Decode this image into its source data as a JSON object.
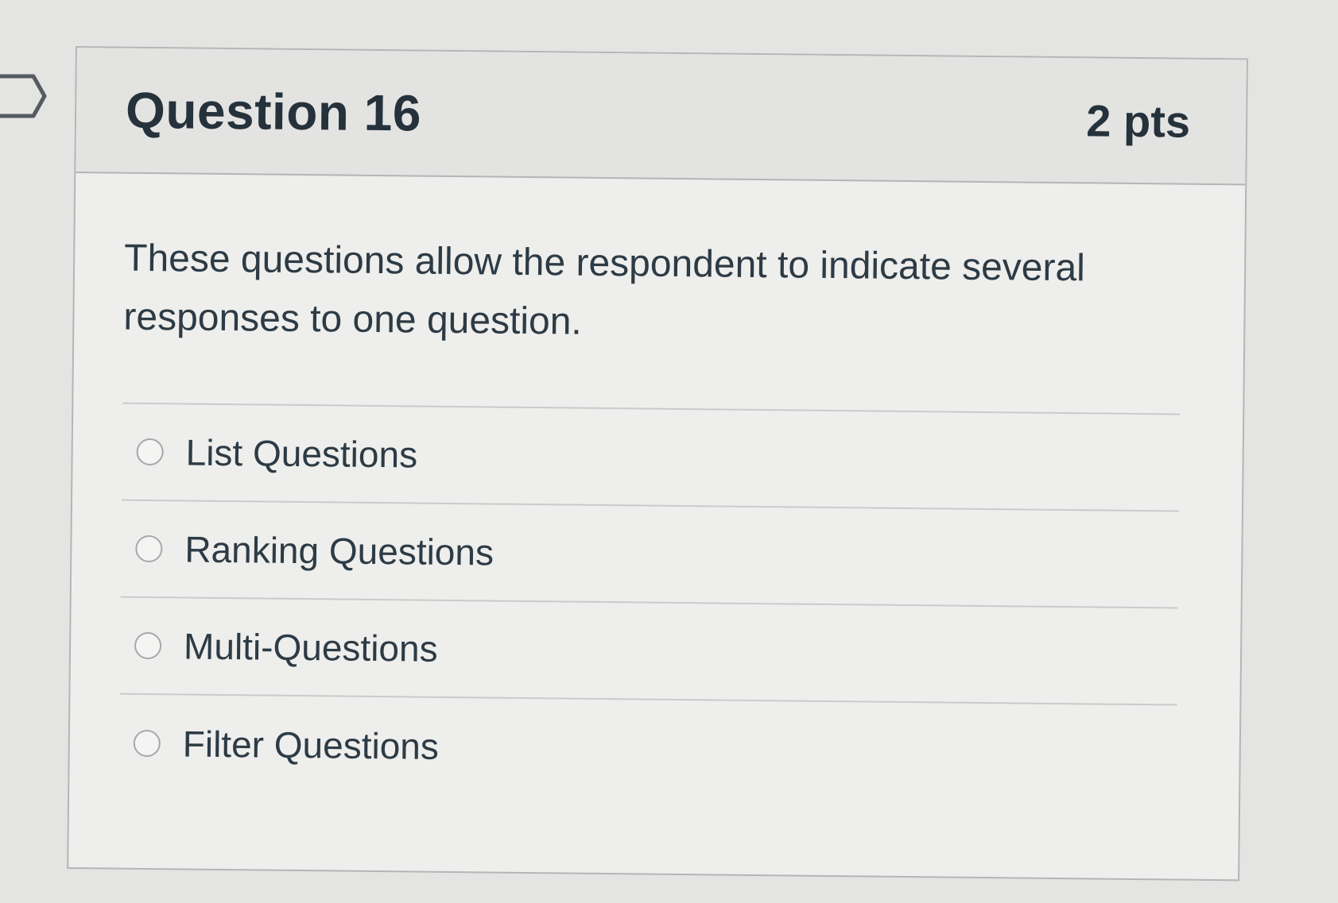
{
  "question": {
    "title": "Question 16",
    "points": "2 pts",
    "text": "These questions allow the respondent to indicate several responses to one question."
  },
  "answers": [
    {
      "label": "List Questions",
      "selected": false
    },
    {
      "label": "Ranking Questions",
      "selected": false
    },
    {
      "label": "Multi-Questions",
      "selected": false
    },
    {
      "label": "Filter Questions",
      "selected": false
    }
  ],
  "colors": {
    "background": "#e4e4e2",
    "card": "#eeeeec",
    "header": "#e3e4e2",
    "text": "#2d3b45",
    "border": "#b3b5b7"
  },
  "icons": {
    "flag": "flag-question-icon",
    "radio": "radio-unchecked-icon"
  }
}
